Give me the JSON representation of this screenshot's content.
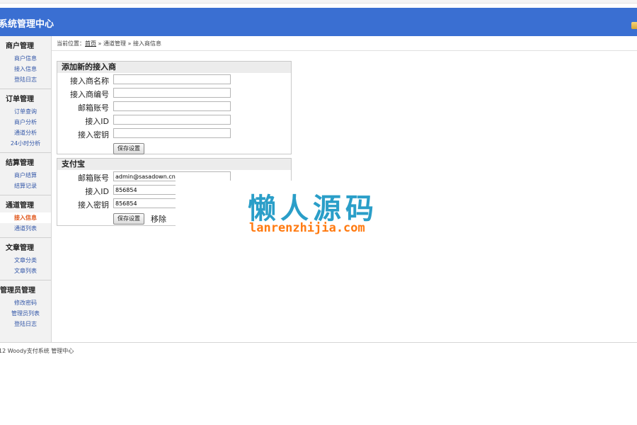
{
  "header": {
    "title": "系统管理中心"
  },
  "sidebar": {
    "groups": [
      {
        "title": "商户管理",
        "items": [
          "商户信息",
          "接入信息",
          "登陆日志"
        ]
      },
      {
        "title": "订单管理",
        "items": [
          "订单查询",
          "商户分析",
          "通道分析",
          "24小时分析"
        ]
      },
      {
        "title": "结算管理",
        "items": [
          "商户结算",
          "结算记录"
        ]
      },
      {
        "title": "通道管理",
        "items": [
          "接入信息",
          "通道列表"
        ]
      },
      {
        "title": "文章管理",
        "items": [
          "文章分类",
          "文章列表"
        ]
      },
      {
        "title": "管理员管理",
        "items": [
          "修改密码",
          "管理员列表",
          "登陆日志"
        ]
      }
    ],
    "active_item": "接入信息"
  },
  "breadcrumb": {
    "prefix": "当前位置：",
    "home": "首页",
    "sep1": " » ",
    "section": "通道管理",
    "sep2": " » ",
    "page": "接入商信息"
  },
  "panel_add": {
    "title": "添加新的接入商",
    "fields": [
      {
        "label": "接入商名称",
        "value": ""
      },
      {
        "label": "接入商编号",
        "value": ""
      },
      {
        "label": "邮箱账号",
        "value": ""
      },
      {
        "label": "接入ID",
        "value": ""
      },
      {
        "label": "接入密钥",
        "value": ""
      }
    ],
    "save_label": "保存设置"
  },
  "panel_alipay": {
    "title": "支付宝",
    "fields": [
      {
        "label": "邮箱账号",
        "value": "admin@sasadown.cn"
      },
      {
        "label": "接入ID",
        "value": "856854"
      },
      {
        "label": "接入密钥",
        "value": "856854"
      }
    ],
    "save_label": "保存设置",
    "remove_label": "移除"
  },
  "watermark": {
    "cn": "懒人源码",
    "url": "lanrenzhijia.com"
  },
  "footer": {
    "text": "12 Woody支付系统 管理中心"
  }
}
